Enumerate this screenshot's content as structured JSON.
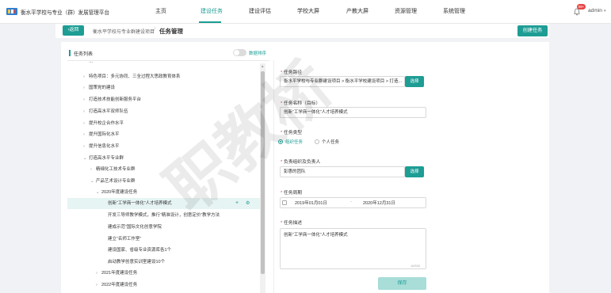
{
  "header": {
    "brand": "衡水平学校与专业（群）发展管理平台",
    "nav": [
      "主页",
      "建设任务",
      "建设评估",
      "学校大屏",
      "产教大屏",
      "资源管理",
      "系统管理"
    ],
    "active_nav": "建设任务",
    "badge": "99+",
    "user": "admin",
    "accent": "#1d9d94"
  },
  "subbar": {
    "back_label": "返回",
    "breadcrumb": "衡水平学校与专业群建设项目",
    "page_title": "任务管理",
    "create_label": "创建任务"
  },
  "left": {
    "title": "任务列表",
    "toggle_label": "数据排序",
    "tree": [
      {
        "label": "…",
        "level": 1,
        "arrow": ""
      },
      {
        "label": "特色项目：多元协同、三全过程大思政教育体系",
        "level": 1,
        "arrow": "›"
      },
      {
        "label": "国策党的建设",
        "level": 1,
        "arrow": "›"
      },
      {
        "label": "打造技术技能创新服务平台",
        "level": 1,
        "arrow": "›"
      },
      {
        "label": "打造高水平双师队伍",
        "level": 1,
        "arrow": "›"
      },
      {
        "label": "提升校企合作水平",
        "level": 1,
        "arrow": "›"
      },
      {
        "label": "提升国际化水平",
        "level": 1,
        "arrow": "›"
      },
      {
        "label": "提升信息化水平",
        "level": 1,
        "arrow": "›"
      },
      {
        "label": "打造高水平专业群",
        "level": 1,
        "arrow": "⌄"
      },
      {
        "label": "精细化工技术专业群",
        "level": 2,
        "arrow": "›"
      },
      {
        "label": "产品艺术设计专业群",
        "level": 2,
        "arrow": "⌄"
      },
      {
        "label": "2020年度建设任务",
        "level": 3,
        "arrow": "⌄"
      },
      {
        "label": "创新“工学商一体化”人才培养模式",
        "level": 4,
        "arrow": "",
        "selected": true
      },
      {
        "label": "开发三导师教学模式，推行“精准设计，创意定价”教学方法",
        "level": 4,
        "arrow": ""
      },
      {
        "label": "建成示范“国际文化创意学院",
        "level": 4,
        "arrow": ""
      },
      {
        "label": "建立“名师工作室”",
        "level": 4,
        "arrow": ""
      },
      {
        "label": "建设国家、省级专业资源库各1个",
        "level": 4,
        "arrow": ""
      },
      {
        "label": "启动教学创意实训室建设10个",
        "level": 4,
        "arrow": ""
      },
      {
        "label": "2021年度建设任务",
        "level": 3,
        "arrow": "›"
      },
      {
        "label": "2022年度建设任务",
        "level": 3,
        "arrow": "›"
      }
    ]
  },
  "form": {
    "path_label": "任务路径",
    "path_value": "衡水平学校与专业群建设项目 > 衡水平学校建设项目 > 打造...",
    "select_label": "选择",
    "name_label": "任务名称（目标）",
    "name_value": "创新“工学商一体化”人才培养模式",
    "type_label": "任务类型",
    "type_options": [
      "组织任务",
      "个人任务"
    ],
    "leader_label": "负责组织及负责人",
    "leader_value": "彭惠的团队",
    "period_label": "任务周期",
    "date_start": "2019年01月01日",
    "date_sep": "-",
    "date_end": "2020年12月31日",
    "desc_label": "任务描述",
    "desc_value": "创新“工学商一体化”人才培养模式",
    "char_count": "16/500",
    "save_label": "保存"
  },
  "watermark": "职教桥"
}
